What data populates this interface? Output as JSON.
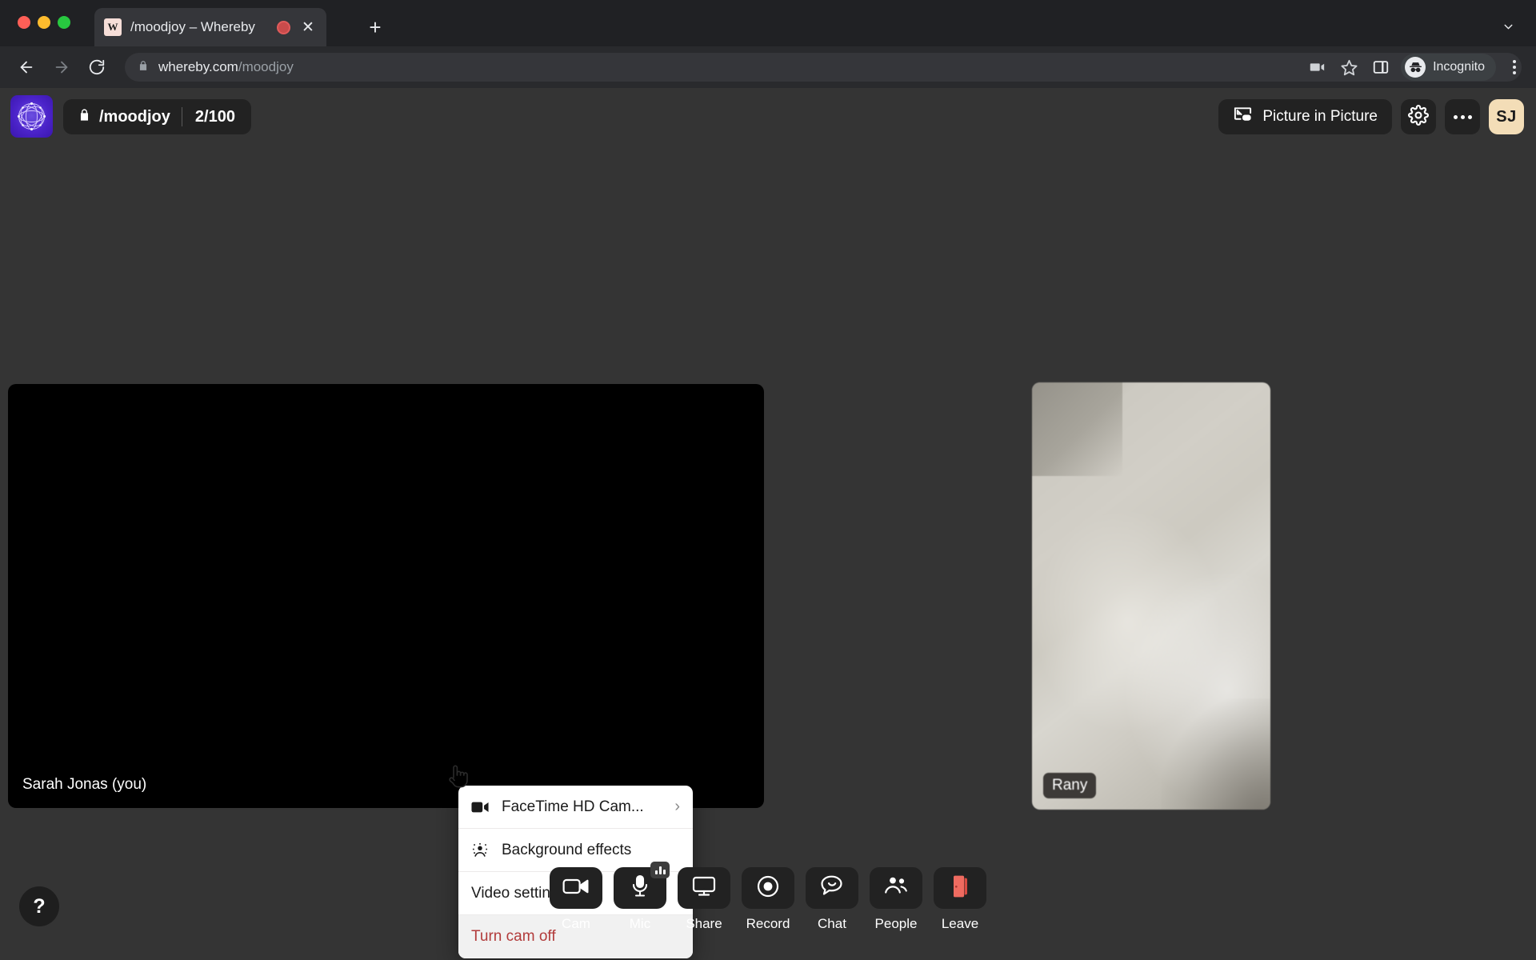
{
  "browser": {
    "window_controls": [
      "close",
      "minimize",
      "maximize"
    ],
    "tab": {
      "favicon_letter": "W",
      "title": "/moodjoy – Whereby",
      "recording_indicator": "recording-dot",
      "close_label": "✕"
    },
    "new_tab_label": "+",
    "nav": {
      "back": "back-arrow",
      "forward": "forward-arrow",
      "reload": "reload-arrow"
    },
    "omnibox": {
      "lock_icon": "lock-icon",
      "domain": "whereby.com",
      "path": "/moodjoy"
    },
    "toolbar_icons": [
      "video-camera-icon",
      "bookmark-star-icon",
      "side-panel-icon"
    ],
    "incognito_label": "Incognito",
    "menu_label": "chrome-menu"
  },
  "app": {
    "header": {
      "logo_name": "whereby-room-logo",
      "room_name": "/moodjoy",
      "lock_icon": "lock-icon",
      "participant_count": "2/100",
      "pip_label": "Picture in Picture",
      "settings_label": "settings-gear",
      "more_label": "more-options",
      "avatar_initials": "SJ"
    },
    "tiles": [
      {
        "id": "self",
        "name": "Sarah Jonas (you)",
        "camera": "off"
      },
      {
        "id": "remote",
        "name": "Rany",
        "camera": "on"
      }
    ],
    "cam_menu": {
      "items": [
        {
          "label": "FaceTime HD Cam...",
          "icon": "video-camera-icon",
          "chevron": "›",
          "type": "submenu"
        },
        {
          "label": "Background effects",
          "icon": "sparkle-person-icon",
          "type": "item"
        },
        {
          "label": "Video settings",
          "icon": null,
          "type": "item"
        },
        {
          "label": "Turn cam off",
          "icon": null,
          "type": "danger"
        }
      ]
    },
    "toolbar": [
      {
        "label": "Cam",
        "icon": "video-camera-icon",
        "badge": null
      },
      {
        "label": "Mic",
        "icon": "microphone-icon",
        "badge": "audio-level"
      },
      {
        "label": "Share",
        "icon": "screen-share-icon",
        "badge": null
      },
      {
        "label": "Record",
        "icon": "record-dot-icon",
        "badge": null
      },
      {
        "label": "Chat",
        "icon": "chat-bubble-icon",
        "badge": null
      },
      {
        "label": "People",
        "icon": "people-icon",
        "badge": null
      },
      {
        "label": "Leave",
        "icon": "leave-door-icon",
        "badge": null
      }
    ],
    "help_label": "?"
  },
  "colors": {
    "page_bg": "#343434",
    "chrome_bg": "#202124",
    "chrome_toolbar": "#292a2d",
    "pill_bg": "#222222",
    "avatar_bg": "#f3ddb7",
    "danger_text": "#b23b3b",
    "leave_icon": "#e8594f",
    "menu_bg": "#ffffff"
  }
}
